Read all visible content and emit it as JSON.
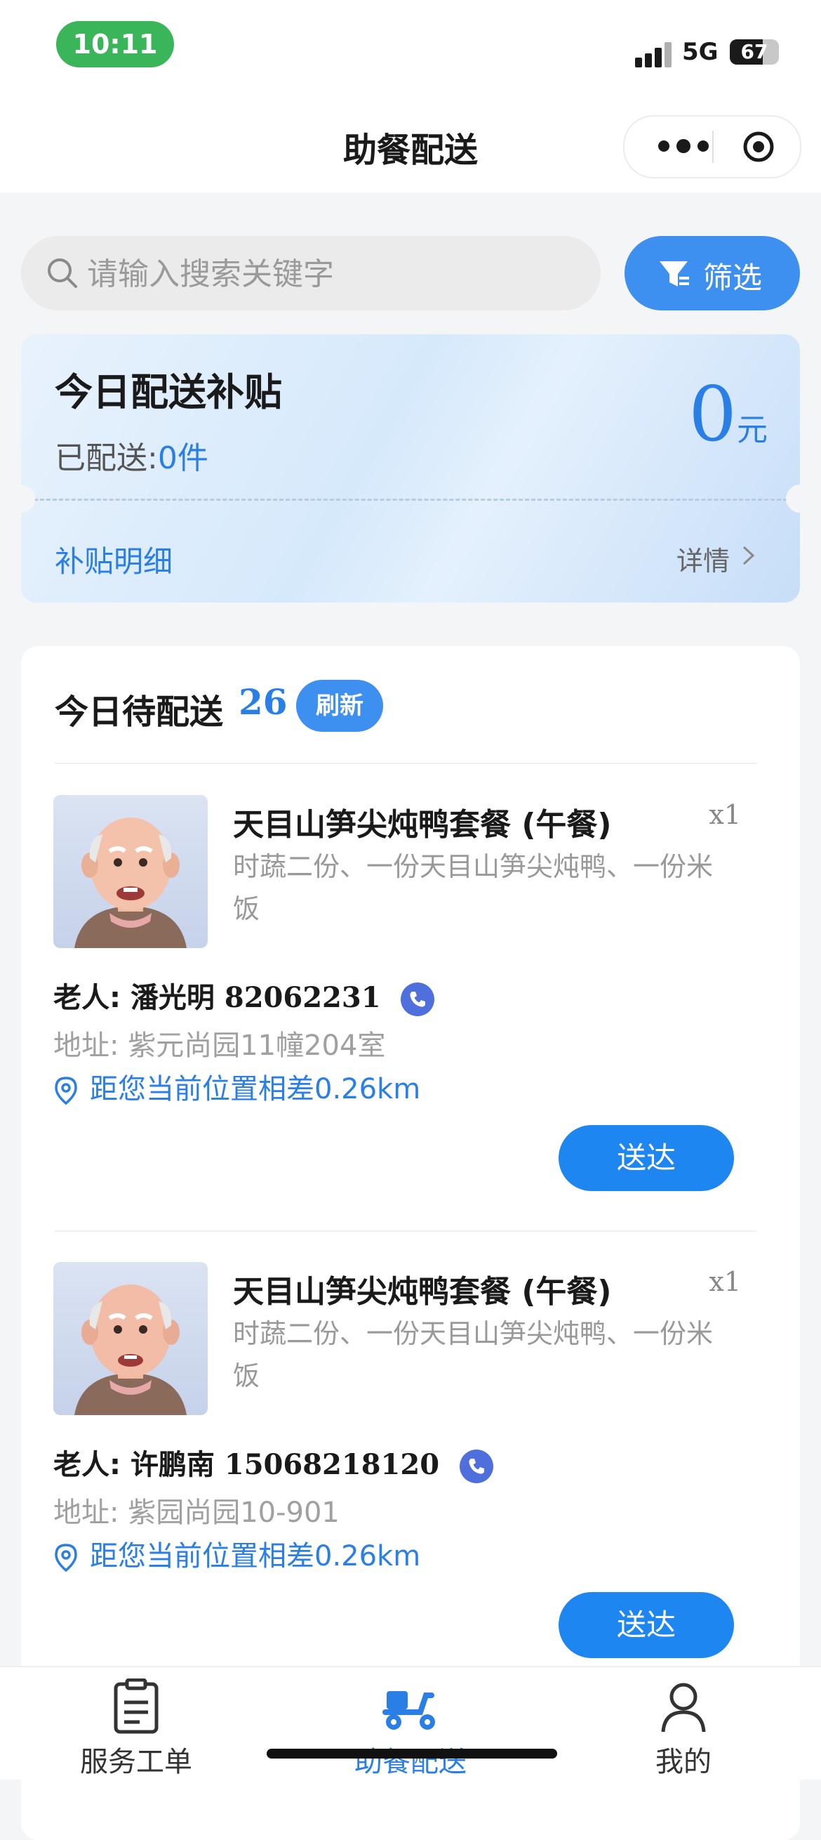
{
  "status_bar": {
    "time": "10:11",
    "network": "5G",
    "battery": "67",
    "battery_level": 0.67
  },
  "nav": {
    "title": "助餐配送"
  },
  "search": {
    "placeholder": "请输入搜索关键字",
    "filter_label": "筛选"
  },
  "subsidy": {
    "title": "今日配送补贴",
    "delivered_label": "已配送:",
    "delivered_count": "0件",
    "amount": "0",
    "amount_unit": "元",
    "detail_label": "补贴明细",
    "more_label": "详情"
  },
  "pending": {
    "title": "今日待配送",
    "count": "26",
    "refresh_label": "刷新",
    "orders": [
      {
        "meal": "天目山笋尖炖鸭套餐 (午餐)",
        "qty": "x1",
        "items": "时蔬二份、一份天目山笋尖炖鸭、一份米饭",
        "elder_label": "老人:",
        "elder_name": "潘光明",
        "phone": "82062231",
        "address": "地址: 紫元尚园11幢204室",
        "distance": "距您当前位置相差0.26km",
        "deliver_label": "送达"
      },
      {
        "meal": "天目山笋尖炖鸭套餐 (午餐)",
        "qty": "x1",
        "items": "时蔬二份、一份天目山笋尖炖鸭、一份米饭",
        "elder_label": "老人:",
        "elder_name": "许鹏南",
        "phone": "15068218120",
        "address": "地址: 紫园尚园10-901",
        "distance": "距您当前位置相差0.26km",
        "deliver_label": "送达"
      }
    ]
  },
  "tabs": [
    {
      "label": "服务工单",
      "icon": "clipboard-icon",
      "active": false
    },
    {
      "label": "助餐配送",
      "icon": "scooter-icon",
      "active": true
    },
    {
      "label": "我的",
      "icon": "user-icon",
      "active": false
    }
  ],
  "colors": {
    "accent": "#1e86f0",
    "time_pill": "#3bb55a",
    "active_tab": "#2a7fe6"
  }
}
